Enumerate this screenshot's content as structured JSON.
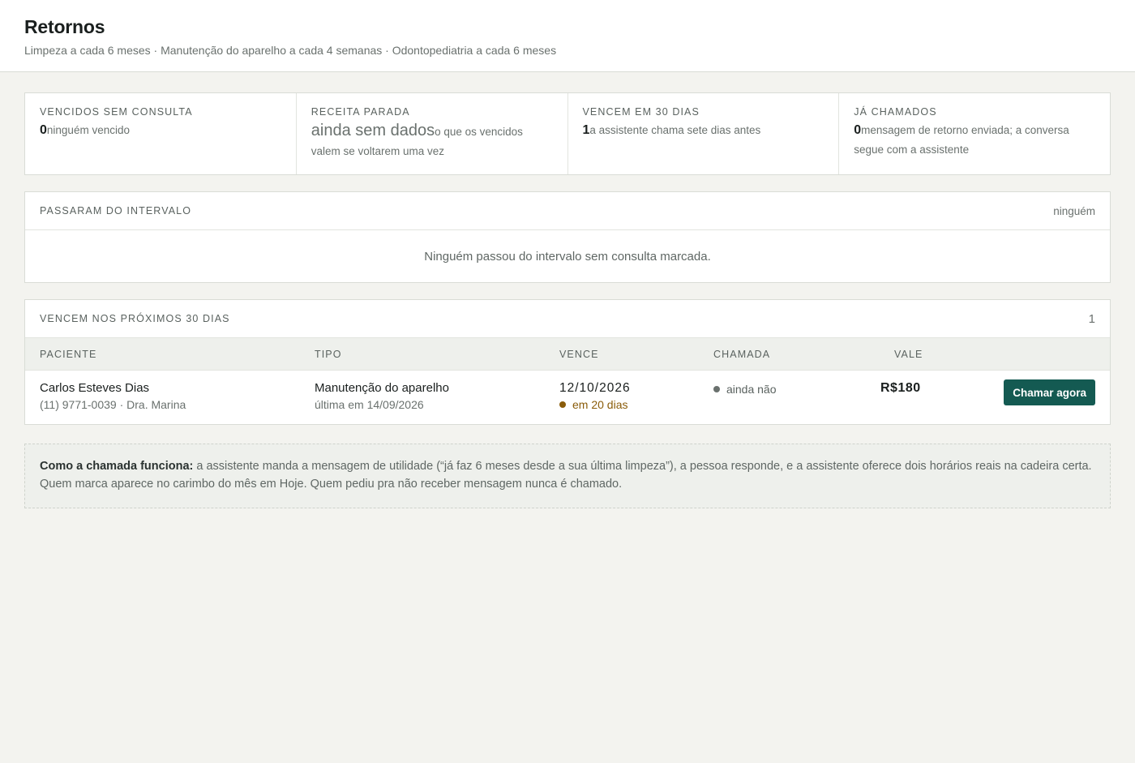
{
  "header": {
    "title": "Retornos",
    "subtitle": "Limpeza a cada 6 meses · Manutenção do aparelho a cada 4 semanas · Odontopediatria a cada 6 meses"
  },
  "stats": [
    {
      "label": "VENCIDOS SEM CONSULTA",
      "value": "0",
      "description": "ninguém vencido"
    },
    {
      "label": "RECEITA PARADA",
      "value": "ainda sem dados",
      "description": "o que os vencidos valem se voltarem uma vez"
    },
    {
      "label": "VENCEM EM 30 DIAS",
      "value": "1",
      "description": "a assistente chama sete dias antes"
    },
    {
      "label": "JÁ CHAMADOS",
      "value": "0",
      "description": "mensagem de retorno enviada; a conversa segue com a assistente"
    }
  ],
  "overdue_panel": {
    "title": "PASSARAM DO INTERVALO",
    "meta": "ninguém",
    "empty_message": "Ninguém passou do intervalo sem consulta marcada."
  },
  "upcoming_panel": {
    "title": "VENCEM NOS PRÓXIMOS 30 DIAS",
    "count": "1",
    "columns": {
      "paciente": "PACIENTE",
      "tipo": "TIPO",
      "vence": "VENCE",
      "chamada": "CHAMADA",
      "vale": "VALE"
    },
    "rows": [
      {
        "patient_name": "Carlos Esteves Dias",
        "patient_details": "(11) 9771-0039 · Dra. Marina",
        "type": "Manutenção do aparelho",
        "type_last": "última em 14/09/2026",
        "due_date": "12/10/2026",
        "due_in": "em 20 dias",
        "call_status": "ainda não",
        "value": "R$180",
        "action_label": "Chamar agora"
      }
    ]
  },
  "note": {
    "title": "Como a chamada funciona:",
    "text": " a assistente manda a mensagem de utilidade (“já faz 6 meses desde a sua última limpeza”), a pessoa responde, e a assistente oferece dois horários reais na cadeira certa. Quem marca aparece no carimbo do mês em Hoje. Quem pediu pra não receber mensagem nunca é chamado."
  },
  "colors": {
    "accent": "#145a52",
    "due_warning": "#8a5c0a",
    "status_dot": "#6a716e"
  }
}
